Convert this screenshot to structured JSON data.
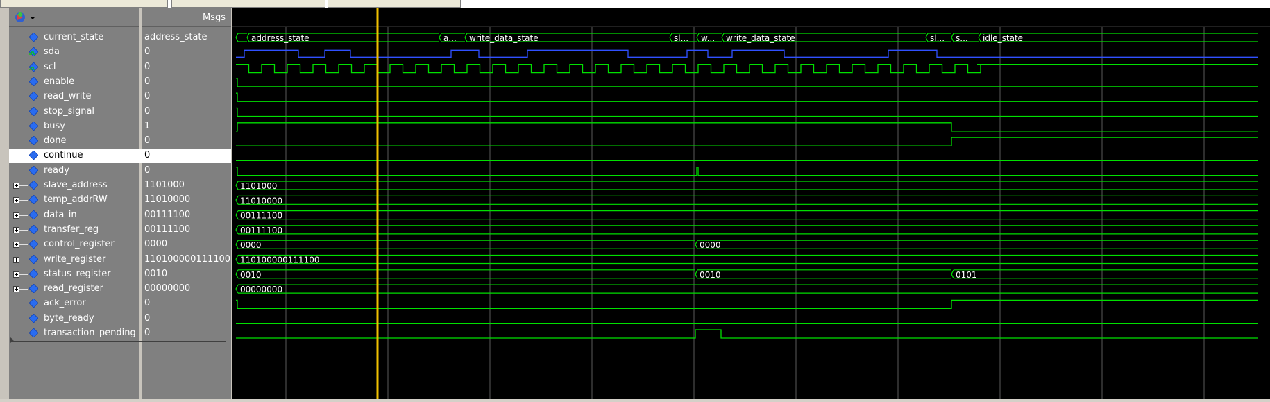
{
  "header": {
    "msgs_label": "Msgs"
  },
  "signals": [
    {
      "name": "current_state",
      "value": "address_state",
      "icon": "diamond-icon",
      "expandable": false
    },
    {
      "name": "sda",
      "value": "0",
      "icon": "sda-net-icon",
      "expandable": false
    },
    {
      "name": "scl",
      "value": "0",
      "icon": "scl-net-icon",
      "expandable": false
    },
    {
      "name": "enable",
      "value": "0",
      "icon": "diamond-icon",
      "expandable": false
    },
    {
      "name": "read_write",
      "value": "0",
      "icon": "diamond-icon",
      "expandable": false
    },
    {
      "name": "stop_signal",
      "value": "0",
      "icon": "diamond-icon",
      "expandable": false
    },
    {
      "name": "busy",
      "value": "1",
      "icon": "diamond-icon",
      "expandable": false
    },
    {
      "name": "done",
      "value": "0",
      "icon": "diamond-icon",
      "expandable": false
    },
    {
      "name": "continue",
      "value": "0",
      "icon": "diamond-icon",
      "expandable": false,
      "selected": true
    },
    {
      "name": "ready",
      "value": "0",
      "icon": "diamond-icon",
      "expandable": false
    },
    {
      "name": "slave_address",
      "value": "1101000",
      "icon": "diamond-icon",
      "expandable": true
    },
    {
      "name": "temp_addrRW",
      "value": "11010000",
      "icon": "diamond-icon",
      "expandable": true
    },
    {
      "name": "data_in",
      "value": "00111100",
      "icon": "diamond-icon",
      "expandable": true
    },
    {
      "name": "transfer_reg",
      "value": "00111100",
      "icon": "diamond-icon",
      "expandable": true
    },
    {
      "name": "control_register",
      "value": "0000",
      "icon": "diamond-icon",
      "expandable": true
    },
    {
      "name": "write_register",
      "value": "110100000111100",
      "icon": "diamond-icon",
      "expandable": true
    },
    {
      "name": "status_register",
      "value": "0010",
      "icon": "diamond-icon",
      "expandable": true
    },
    {
      "name": "read_register",
      "value": "00000000",
      "icon": "diamond-icon",
      "expandable": true
    },
    {
      "name": "ack_error",
      "value": "0",
      "icon": "diamond-icon",
      "expandable": false
    },
    {
      "name": "byte_ready",
      "value": "0",
      "icon": "diamond-icon",
      "expandable": false
    },
    {
      "name": "transaction_pending",
      "value": "0",
      "icon": "diamond-icon",
      "expandable": false
    }
  ],
  "waveform_labels": {
    "current_state": [
      "address_state",
      "a...",
      "write_data_state",
      "sl...",
      "w...",
      "write_data_state",
      "sl...",
      "s...",
      "idle_state"
    ],
    "slave_address": [
      "1101000"
    ],
    "temp_addrRW": [
      "11010000"
    ],
    "data_in": [
      "00111100"
    ],
    "transfer_reg": [
      "00111100"
    ],
    "control_register": [
      "0000",
      "0000"
    ],
    "write_register": [
      "110100000111100"
    ],
    "status_register": [
      "0010",
      "0010",
      "0101"
    ],
    "read_register": [
      "00000000"
    ]
  },
  "colors": {
    "wave_green": "#00e000",
    "sda_blue": "#3050ff",
    "cursor_yellow": "#f0c000",
    "grid": "#5a5a5a",
    "background": "#000000",
    "panel_gray": "#808080"
  }
}
